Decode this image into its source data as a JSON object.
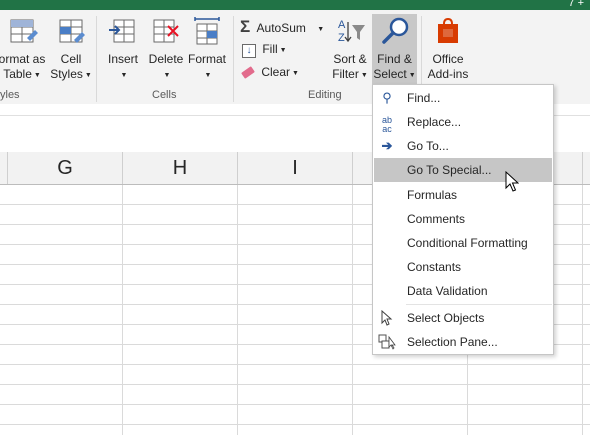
{
  "titlebar": {
    "qs_text": "7 +"
  },
  "ribbon": {
    "styles": {
      "format_as_table": [
        "ormat as",
        "Table"
      ],
      "cell_styles": [
        "Cell",
        "Styles"
      ],
      "group_label": "yles"
    },
    "cells": {
      "insert": "Insert",
      "delete": "Delete",
      "format": "Format",
      "group_label": "Cells"
    },
    "editing": {
      "autosum": "AutoSum",
      "fill": "Fill",
      "clear": "Clear",
      "sort_filter": [
        "Sort &",
        "Filter"
      ],
      "find_select": [
        "Find &",
        "Select"
      ],
      "group_label": "Editing"
    },
    "addins": {
      "office_addins": [
        "Office",
        "Add-ins"
      ]
    }
  },
  "columns": [
    "G",
    "H",
    "I"
  ],
  "menu": {
    "items": [
      {
        "label": "Find...",
        "icon": "search-icon"
      },
      {
        "label": "Replace...",
        "icon": "replace-icon"
      },
      {
        "label": "Go To...",
        "icon": "arrow-right-icon"
      },
      {
        "label": "Go To Special...",
        "icon": ""
      },
      {
        "label": "Formulas",
        "icon": ""
      },
      {
        "label": "Comments",
        "icon": ""
      },
      {
        "label": "Conditional Formatting",
        "icon": ""
      },
      {
        "label": "Constants",
        "icon": ""
      },
      {
        "label": "Data Validation",
        "icon": ""
      },
      {
        "label": "Select Objects",
        "icon": "select-objects-icon"
      },
      {
        "label": "Selection Pane...",
        "icon": "selection-pane-icon"
      }
    ],
    "highlighted_index": 3
  },
  "colors": {
    "brand": "#217346",
    "office_addins": "#d83b01",
    "highlight": "#c6c6c6",
    "accent_blue": "#2b579a"
  }
}
